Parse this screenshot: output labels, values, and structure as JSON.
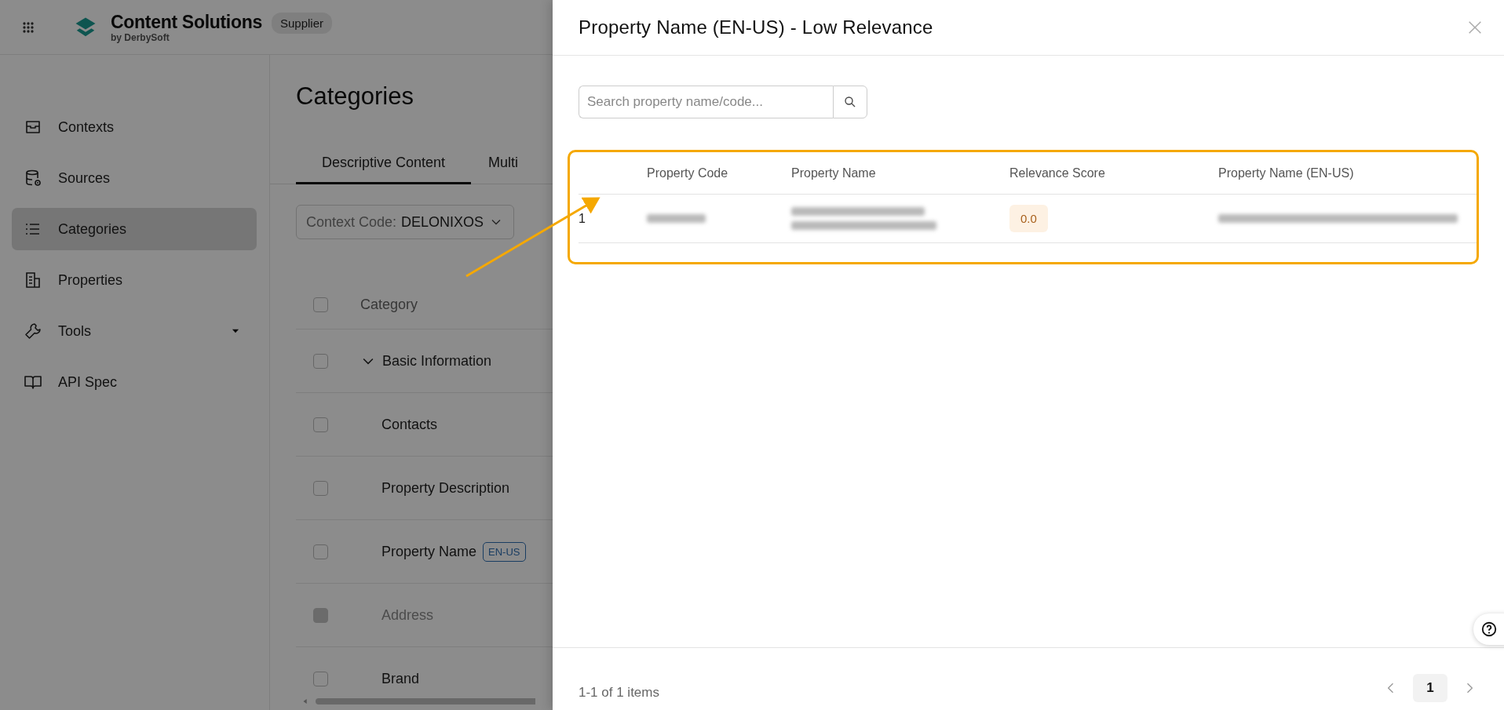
{
  "header": {
    "app_name": "Content Solutions",
    "byline": "by DerbySoft",
    "badge": "Supplier"
  },
  "sidebar": {
    "items": [
      {
        "label": "Contexts",
        "selected": false,
        "dropdown": false
      },
      {
        "label": "Sources",
        "selected": false,
        "dropdown": false
      },
      {
        "label": "Categories",
        "selected": true,
        "dropdown": false
      },
      {
        "label": "Properties",
        "selected": false,
        "dropdown": false
      },
      {
        "label": "Tools",
        "selected": false,
        "dropdown": true
      },
      {
        "label": "API Spec",
        "selected": false,
        "dropdown": false
      }
    ]
  },
  "main": {
    "title": "Categories",
    "tabs": [
      {
        "label": "Descriptive Content",
        "selected": true
      },
      {
        "label": "Multi",
        "selected": false
      }
    ],
    "context_select": {
      "label": "Context Code:",
      "value": "DELONIXOS"
    },
    "table": {
      "columns": [
        "Category"
      ],
      "all_checked": false,
      "rows": [
        {
          "label": "Basic Information",
          "checked": false,
          "disabled": false,
          "expanded": true,
          "children": [
            {
              "label": "Contacts",
              "checked": false,
              "disabled": false
            },
            {
              "label": "Property Description",
              "checked": false,
              "disabled": false
            },
            {
              "label": "Property Name",
              "checked": false,
              "disabled": false,
              "tag": "EN-US"
            },
            {
              "label": "Address",
              "checked": false,
              "disabled": true
            },
            {
              "label": "Brand",
              "checked": false,
              "disabled": false
            }
          ]
        }
      ]
    }
  },
  "drawer": {
    "title": "Property Name (EN-US) - Low Relevance",
    "search": {
      "placeholder": "Search property name/code..."
    },
    "table": {
      "columns": [
        "Property Code",
        "Property Name",
        "Relevance Score",
        "Property Name (EN-US)"
      ],
      "rows": [
        {
          "index": "1",
          "relevance_score": "0.0"
        }
      ]
    },
    "pagination": {
      "summary": "1-1 of 1 items",
      "pages": [
        {
          "label": "1",
          "selected": true
        }
      ]
    }
  }
}
